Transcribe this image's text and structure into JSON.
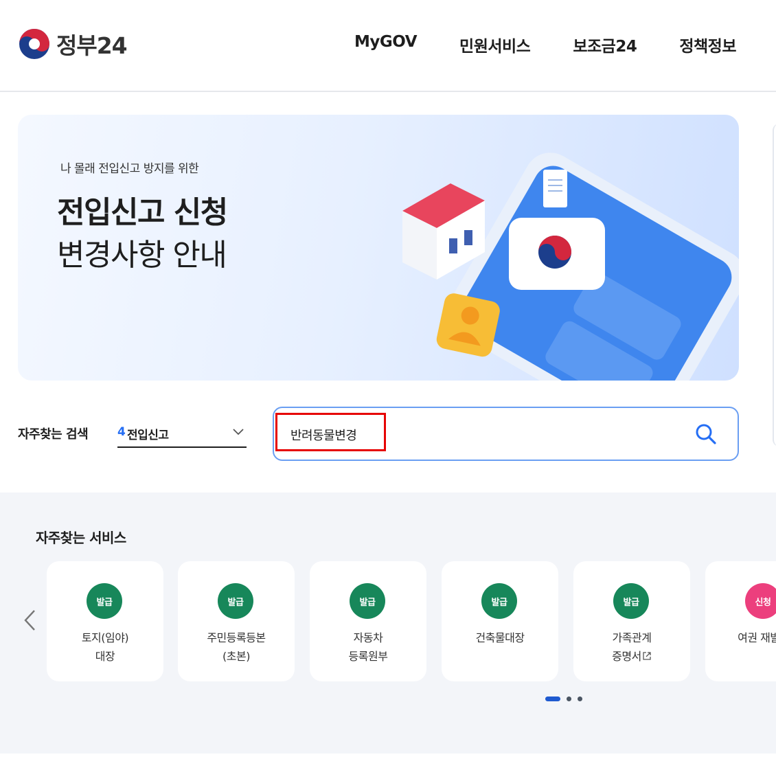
{
  "header": {
    "logo_text": "정부24",
    "nav": [
      "MyGOV",
      "민원서비스",
      "보조금24",
      "정책정보"
    ]
  },
  "banner": {
    "subtitle": "나 몰래 전입신고 방지를 위한",
    "title_line1": "전입신고 신청",
    "title_line2": "변경사항 안내"
  },
  "search": {
    "quick_label": "자주찾는 검색",
    "selected_rank": "4",
    "selected_term": "전입신고",
    "input_value": "반려동물변경"
  },
  "services": {
    "title": "자주찾는 서비스",
    "cards": [
      {
        "badge": "발급",
        "label": "토지(임야)\n대장"
      },
      {
        "badge": "발급",
        "label": "주민등록등본\n(초본)"
      },
      {
        "badge": "발급",
        "label": "자동차\n등록원부"
      },
      {
        "badge": "발급",
        "label": "건축물대장"
      },
      {
        "badge": "발급",
        "label": "가족관계\n증명서"
      },
      {
        "badge": "신청",
        "label": "여권 재발급"
      }
    ]
  },
  "colors": {
    "accent_blue": "#256ef4",
    "badge_green": "#17875a",
    "badge_pink": "#ec3f7d",
    "highlight_red": "#e60000"
  },
  "icons": [
    "taegeuk-logo-icon",
    "chevron-down-icon",
    "search-icon",
    "chevron-left-icon",
    "external-link-icon"
  ]
}
